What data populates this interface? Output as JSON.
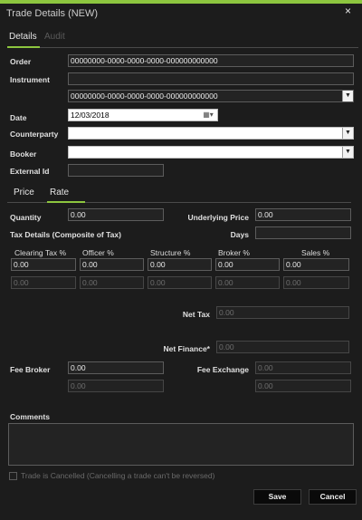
{
  "window": {
    "title": "Trade Details (NEW)",
    "close_glyph": "×"
  },
  "tabs": [
    {
      "label": "Details"
    },
    {
      "label": "Audit"
    }
  ],
  "form": {
    "order_label": "Order",
    "order_value": "00000000-0000-0000-0000-000000000000",
    "instrument_label": "Instrument",
    "instrument_value": "",
    "instrument_select_value": "00000000-0000-0000-0000-000000000000",
    "date_label": "Date",
    "date_value": "12/03/2018",
    "counterparty_label": "Counterparty",
    "counterparty_value": "",
    "booker_label": "Booker",
    "booker_value": "",
    "external_id_label": "External Id",
    "external_id_value": ""
  },
  "subtabs": [
    {
      "label": "Price"
    },
    {
      "label": "Rate"
    }
  ],
  "rate": {
    "quantity_label": "Quantity",
    "quantity_value": "0.00",
    "underlying_price_label": "Underlying Price",
    "underlying_price_value": "0.00",
    "tax_details_label": "Tax Details (Composite of Tax)",
    "days_label": "Days",
    "days_value": "",
    "tax_columns": [
      {
        "label": "Clearing Tax %",
        "value": "0.00",
        "sub_value": "0.00"
      },
      {
        "label": "Officer  %",
        "value": "0.00",
        "sub_value": "0.00"
      },
      {
        "label": "Structure  %",
        "value": "0.00",
        "sub_value": "0.00"
      },
      {
        "label": "Broker %",
        "value": "0.00",
        "sub_value": "0.00"
      },
      {
        "label": "Sales %",
        "value": "0.00",
        "sub_value": "0.00"
      }
    ],
    "net_tax_label": "Net Tax",
    "net_tax_value": "0.00",
    "net_finance_label": "Net Finance*",
    "net_finance_value": "0.00",
    "fee_broker_label": "Fee Broker",
    "fee_broker_value": "0.00",
    "fee_broker_sub_value": "0.00",
    "fee_exchange_label": "Fee Exchange",
    "fee_exchange_value": "0.00",
    "fee_exchange_sub_value": "0.00"
  },
  "comments": {
    "label": "Comments",
    "value": ""
  },
  "cancelled": {
    "label": "Trade is Cancelled (Cancelling a trade can't be reversed)",
    "checked": false
  },
  "buttons": {
    "save": "Save",
    "cancel": "Cancel"
  },
  "icons": {
    "dropdown": "chevron-down-icon",
    "calendar": "calendar-icon",
    "close": "close-icon"
  },
  "colors": {
    "accent": "#8dc63f",
    "background": "#1c1c1c"
  }
}
